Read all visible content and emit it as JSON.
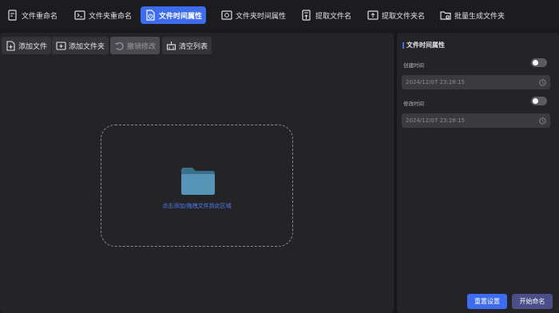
{
  "tabs": [
    {
      "label": "文件重命名",
      "icon": "file-rename-icon"
    },
    {
      "label": "文件夹重命名",
      "icon": "folder-rename-icon"
    },
    {
      "label": "文件时间属性",
      "icon": "file-time-icon",
      "active": true
    },
    {
      "label": "文件夹时间属性",
      "icon": "folder-time-icon"
    },
    {
      "label": "提取文件名",
      "icon": "extract-filename-icon"
    },
    {
      "label": "提取文件夹名",
      "icon": "extract-foldername-icon"
    },
    {
      "label": "批量生成文件夹",
      "icon": "batch-folder-icon"
    }
  ],
  "toolbar": {
    "add_file": "添加文件",
    "add_folder": "添加文件夹",
    "undo": "撤销修改",
    "clear": "清空列表"
  },
  "dropzone": {
    "hint": "点击添加/拖拽文件到此区域"
  },
  "side": {
    "title": "文件时间属性",
    "created_label": "创建时间",
    "created_value": "2024/12/07 23:28:15",
    "modified_label": "修改时间",
    "modified_value": "2024/12/07 23:28:15",
    "created_enabled": false,
    "modified_enabled": false
  },
  "actions": {
    "reset": "重置设置",
    "start": "开始命名"
  },
  "colors": {
    "accent": "#3d6cf0",
    "background": "#18181a",
    "panel": "#242427"
  }
}
